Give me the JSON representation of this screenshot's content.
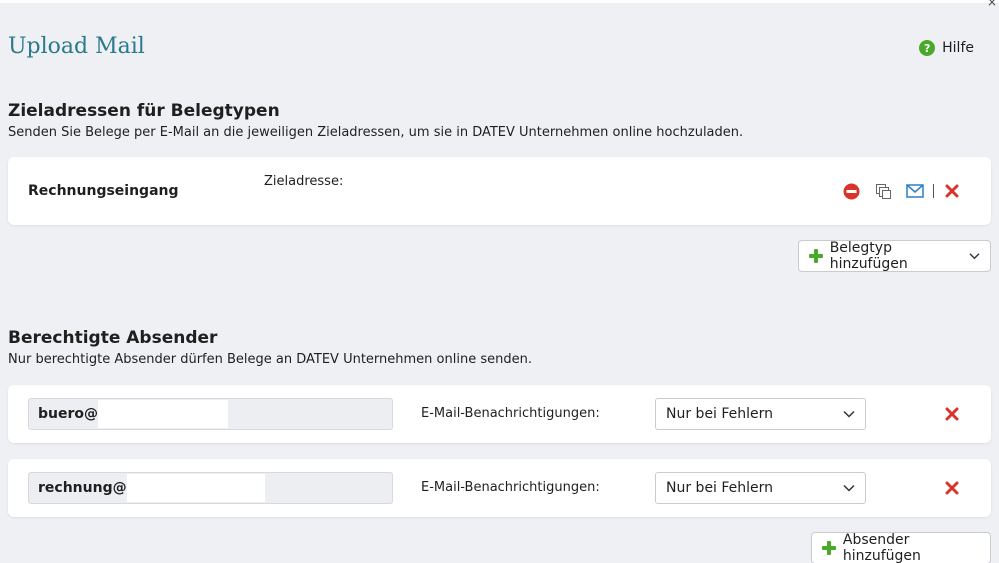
{
  "window": {
    "title": "Upload Mail",
    "close_glyph": "×"
  },
  "help": {
    "label": "Hilfe",
    "icon": "help-icon",
    "icon_glyph": "?"
  },
  "doc_types_section": {
    "title": "Zieladressen für Belegtypen",
    "description": "Senden Sie Belege per E-Mail an die jeweiligen Zieladressen, um sie in DATEV Unternehmen online hochzuladen.",
    "items": [
      {
        "name": "Rechnungseingang",
        "address_label": "Zieladresse:",
        "actions": [
          "deactivate-icon",
          "copy-icon",
          "mail-icon",
          "delete-icon"
        ]
      }
    ],
    "add_button_label": "Belegtyp hinzufügen"
  },
  "senders_section": {
    "title": "Berechtigte Absender",
    "description": "Nur berechtigte Absender dürfen Belege an DATEV Unternehmen online senden.",
    "items": [
      {
        "email": "buero@",
        "notification_label": "E-Mail-Benachrichtigungen:",
        "notification_value": "Nur bei Fehlern"
      },
      {
        "email": "rechnung@",
        "notification_label": "E-Mail-Benachrichtigungen:",
        "notification_value": "Nur bei Fehlern"
      }
    ],
    "add_button_label": "Absender hinzufügen"
  },
  "colors": {
    "title": "#2b7a8c",
    "green": "#4aa82a",
    "red": "#d9342b",
    "blue": "#2a7fc4",
    "background": "#eef0f3"
  }
}
